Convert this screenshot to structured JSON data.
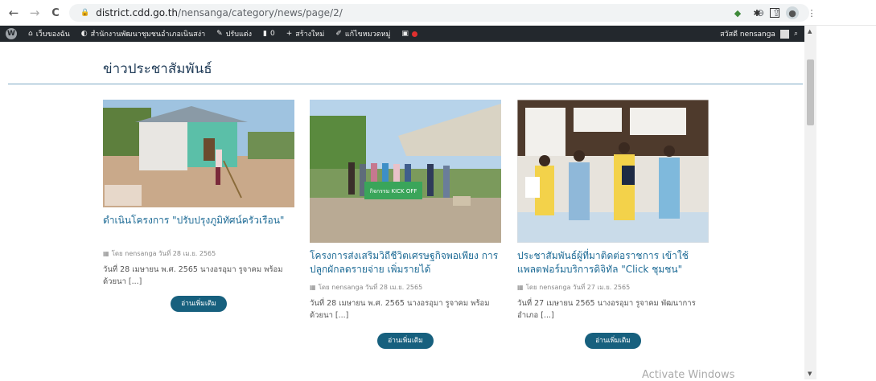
{
  "browser": {
    "back": "←",
    "forward": "→",
    "reload": "C",
    "url_domain": "district.cdd.go.th",
    "url_path": "/nensanga/category/news/page/2/"
  },
  "wp_admin_bar": {
    "site_name": "เว็บของฉัน",
    "office": "สำนักงานพัฒนาชุมชนอำเภอเนินสง่า",
    "customize": "ปรับแต่ง",
    "comments_count": "0",
    "new": "สร้างใหม่",
    "edit_category": "แก้ไขหมวดหมู่",
    "greeting": "สวัสดี nensanga"
  },
  "section": {
    "title": "ข่าวประชาสัมพันธ์"
  },
  "posts": [
    {
      "title": "ดำเนินโครงการ \"ปรับปรุงภูมิทัศน์ครัวเรือน\"",
      "meta": "โดย nensanga วันที่ 28 เม.ย. 2565",
      "excerpt": "วันที่ 28 เมษายน พ.ศ. 2565 นางอรอุมา รูจาคม พร้อมด้วยนา [...]",
      "button": "อ่านเพิ่มเติม"
    },
    {
      "title": "โครงการส่งเสริมวิถีชีวิตเศรษฐกิจพอเพียง การปลูกผักลดรายจ่าย เพิ่มรายได้",
      "meta": "โดย nensanga วันที่ 28 เม.ย. 2565",
      "excerpt": "วันที่ 28 เมษายน พ.ศ. 2565 นางอรอุมา รูจาคม พร้อมด้วยนา [...]",
      "button": "อ่านเพิ่มเติม",
      "banner": "กิจกรรม KICK OFF"
    },
    {
      "title": "ประชาสัมพันธ์ผู้ที่มาติดต่อราชการ เข้าใช้แพลตฟอร์มบริการดิจิทัล \"Click ชุมชน\"",
      "meta": "โดย nensanga วันที่ 27 เม.ย. 2565",
      "excerpt": "วันที่ 27 เมษายน 2565 นางอรอุมา รูจาคม พัฒนาการอำเภอ [...]",
      "button": "อ่านเพิ่มเติม"
    }
  ],
  "overlay": {
    "activate": "Activate Windows"
  }
}
